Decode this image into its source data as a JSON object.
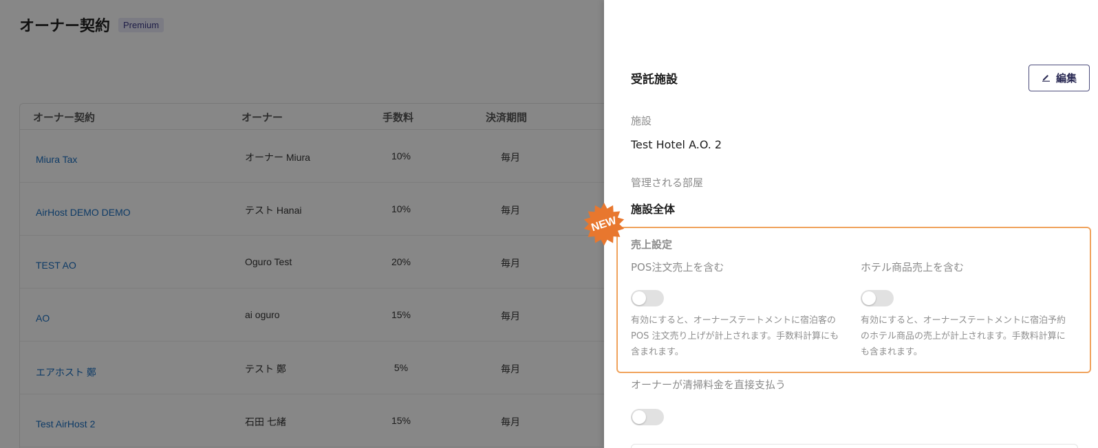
{
  "page": {
    "title": "オーナー契約",
    "badge": "Premium",
    "table": {
      "columns": [
        "オーナー契約",
        "オーナー",
        "手数料",
        "決済期間"
      ],
      "rows": [
        {
          "contract": "Miura Tax",
          "owner": "オーナー Miura",
          "fee": "10%",
          "period": "毎月"
        },
        {
          "contract": "AirHost DEMO DEMO",
          "owner": "テスト Hanai",
          "fee": "10%",
          "period": "毎月"
        },
        {
          "contract": "TEST AO",
          "owner": "Oguro Test",
          "fee": "20%",
          "period": "毎月"
        },
        {
          "contract": "AO",
          "owner": "ai oguro",
          "fee": "15%",
          "period": "毎月"
        },
        {
          "contract": "エアホスト 鄭",
          "owner": "テスト 鄭",
          "fee": "5%",
          "period": "毎月"
        },
        {
          "contract": "Test AirHost 2",
          "owner": "石田 七緒",
          "fee": "15%",
          "period": "毎月"
        }
      ]
    }
  },
  "panel": {
    "title": "受託施設",
    "edit_label": "編集",
    "facility_label": "施設",
    "facility_value": "Test Hotel A.O. 2",
    "rooms_label": "管理される部屋",
    "rooms_value": "施設全体",
    "new_badge": "NEW",
    "sales_settings": {
      "title": "売上設定",
      "pos": {
        "label": "POS注文売上を含む",
        "enabled": false,
        "desc_lines": [
          "有効にすると、オーナーステートメントに宿泊客の",
          "POS 注文売り上げが計上されます。手数料計算にも",
          "含まれます。"
        ]
      },
      "hotel_goods": {
        "label": "ホテル商品売上を含む",
        "enabled": false,
        "desc_lines": [
          "有効にすると、オーナーステートメントに宿泊予約",
          "のホテル商品の売上が計上されます。手数料計算に",
          "も含まれます。"
        ]
      }
    },
    "cleaning": {
      "label": "オーナーが清掃料金を直接支払う",
      "enabled": false
    }
  },
  "colors": {
    "accent_orange": "#f0a25b",
    "badge_orange": "#e8772e",
    "link_blue": "#1a6fc0",
    "overlay": "rgba(0,0,0,0.47)"
  }
}
